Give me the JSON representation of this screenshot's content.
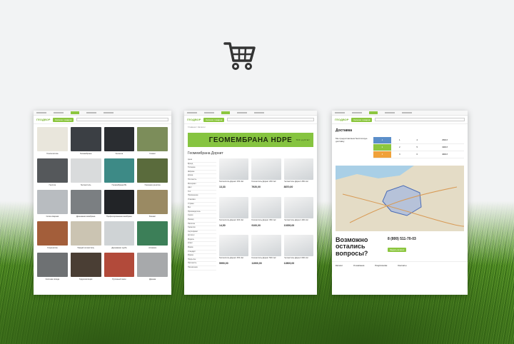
{
  "brand": {
    "name": "ГЕОДВОР",
    "accent": "#8cc63f",
    "catalog_btn": "Каталог товаров",
    "search_placeholder": "Поиск",
    "phone": "8 (800) 511-70-03"
  },
  "cart_icon": "shopping-cart-icon",
  "screen1": {
    "tiles": [
      {
        "label": "Геосинтетика",
        "color": "#e9e6dc"
      },
      {
        "label": "Геомембрана",
        "color": "#3b3f44"
      },
      {
        "label": "Геосетка",
        "color": "#2a2d31"
      },
      {
        "label": "Геомат",
        "color": "#7c8d5a"
      },
      {
        "label": "Геосота",
        "color": "#55585b"
      },
      {
        "label": "Геотекстиль",
        "color": "#d9dbdc"
      },
      {
        "label": "Геомембрана PE",
        "color": "#3d8a86"
      },
      {
        "label": "Газонная решётка",
        "color": "#5a6b3c"
      },
      {
        "label": "Сетка сварная",
        "color": "#b8bcc0"
      },
      {
        "label": "Дренажная мембрана",
        "color": "#7b7f82"
      },
      {
        "label": "Профилированная мембрана",
        "color": "#222427"
      },
      {
        "label": "Биомат",
        "color": "#9a8a63"
      },
      {
        "label": "Георешётка",
        "color": "#a35e3a"
      },
      {
        "label": "Тканый геотекстиль",
        "color": "#cbc4b2"
      },
      {
        "label": "Дренажная труба",
        "color": "#cfd3d5"
      },
      {
        "label": "Armaturа",
        "color": "#3c7f58"
      },
      {
        "label": "Система отвода",
        "color": "#6e7173"
      },
      {
        "label": "Гидроизоляция",
        "color": "#4a3e34"
      },
      {
        "label": "Рулонный газон",
        "color": "#b24a3a"
      },
      {
        "label": "Дренаж",
        "color": "#a7a9ab"
      }
    ]
  },
  "screen2": {
    "banner": "ГЕОМЕМБРАНА HDPE",
    "banner_sub": "700 руб/м²",
    "breadcrumb": "Главная / Каталог",
    "page_title": "Геомембрана Дорнит",
    "sidebar": [
      "Цена",
      "Бренд",
      "Толщина",
      "Ширина",
      "Длина",
      "Плотность",
      "Материал",
      "Цвет",
      "Тип",
      "Применение",
      "Упаковка",
      "Страна",
      "Вес",
      "Производитель",
      "Серия",
      "Размер",
      "Наличие",
      "Гарантия",
      "Сертификат",
      "Артикул",
      "Модель",
      "Класс",
      "Марка",
      "Стандарт",
      "Форма",
      "Покрытие",
      "Прочность",
      "Назначение"
    ],
    "products": [
      {
        "name": "Геотекстиль Дорнит 150 г/м²",
        "price": "13,33"
      },
      {
        "name": "Геотекстиль Дорнит 200 г/м²",
        "price": "7920,00"
      },
      {
        "name": "Геотекстиль Дорнит 250 г/м²",
        "price": "8870,00"
      },
      {
        "name": "Геотекстиль Дорнит 300 г/м²",
        "price": "14,50"
      },
      {
        "name": "Геотекстиль Дорнит 350 г/м²",
        "price": "9100,00"
      },
      {
        "name": "Геотекстиль Дорнит 400 г/м²",
        "price": "10350,00"
      },
      {
        "name": "Геотекстиль Дорнит 450 г/м²",
        "price": "5990,00"
      },
      {
        "name": "Геотекстиль Дорнит 500 г/м²",
        "price": "11900,00"
      },
      {
        "name": "Геотекстиль Дорнит 600 г/м²",
        "price": "12800,00"
      }
    ]
  },
  "screen3": {
    "title": "Доставка",
    "text": "Мы предоставляем бесплатную доставку",
    "rows": [
      {
        "n": "1",
        "a": "1",
        "b": "4",
        "c": "2500 ₽",
        "color": "#5b8ec9"
      },
      {
        "n": "2",
        "a": "2",
        "b": "5",
        "c": "3400 ₽",
        "color": "#8cc63f"
      },
      {
        "n": "3",
        "a": "3",
        "b": "6",
        "c": "4600 ₽",
        "color": "#f0a13a"
      }
    ],
    "question": "Возможно остались вопросы?",
    "button": "Задать вопрос",
    "footer": [
      "Каталог",
      "О компании",
      "Покупателям",
      "Контакты"
    ]
  }
}
